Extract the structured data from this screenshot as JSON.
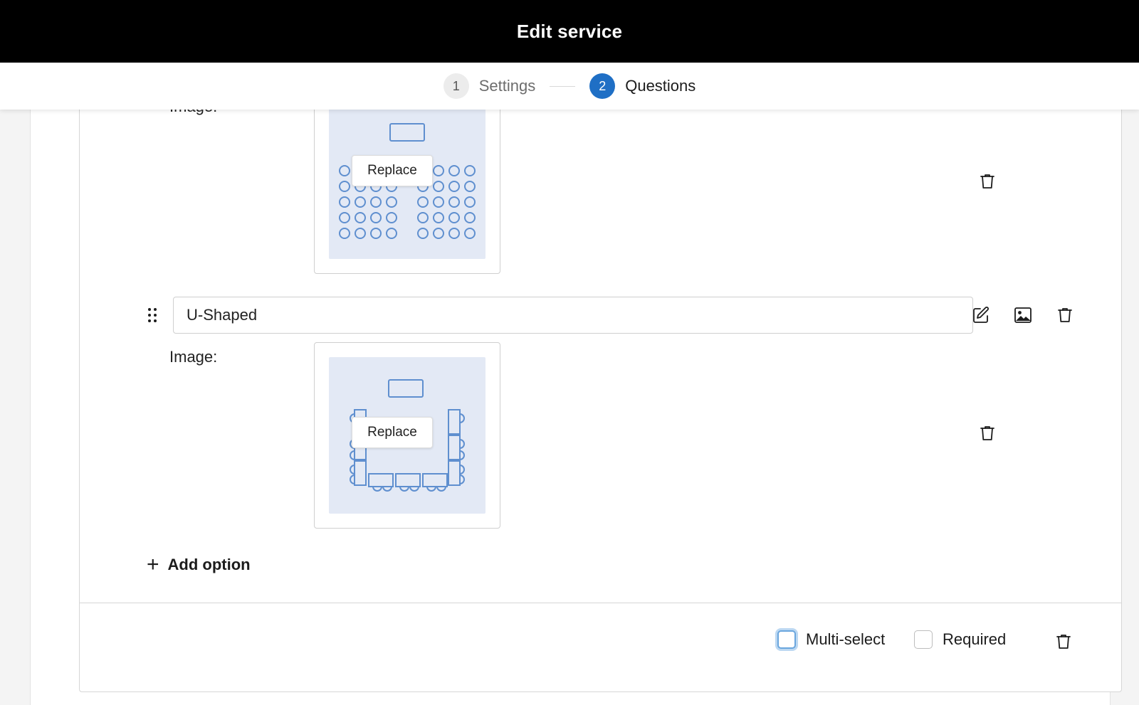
{
  "header": {
    "title": "Edit service"
  },
  "stepper": {
    "steps": [
      {
        "number": "1",
        "label": "Settings",
        "state": "inactive"
      },
      {
        "number": "2",
        "label": "Questions",
        "state": "active"
      }
    ]
  },
  "options": [
    {
      "value": "",
      "image_label": "Image:",
      "image_layout": "classroom",
      "replace_label": "Replace"
    },
    {
      "value": "U-Shaped",
      "image_label": "Image:",
      "image_layout": "u-shaped",
      "replace_label": "Replace"
    }
  ],
  "add_option_label": "Add option",
  "footer": {
    "multi_select_label": "Multi-select",
    "required_label": "Required",
    "multi_select_checked": false,
    "required_checked": false
  },
  "colors": {
    "accent": "#1f6fc5",
    "thumb_bg": "#e3e9f5",
    "diagram_stroke": "#5f8fcf",
    "focus_ring": "#bcd8f2"
  },
  "icons": [
    "drag-handle-icon",
    "edit-icon",
    "image-icon",
    "trash-icon",
    "plus-icon"
  ]
}
